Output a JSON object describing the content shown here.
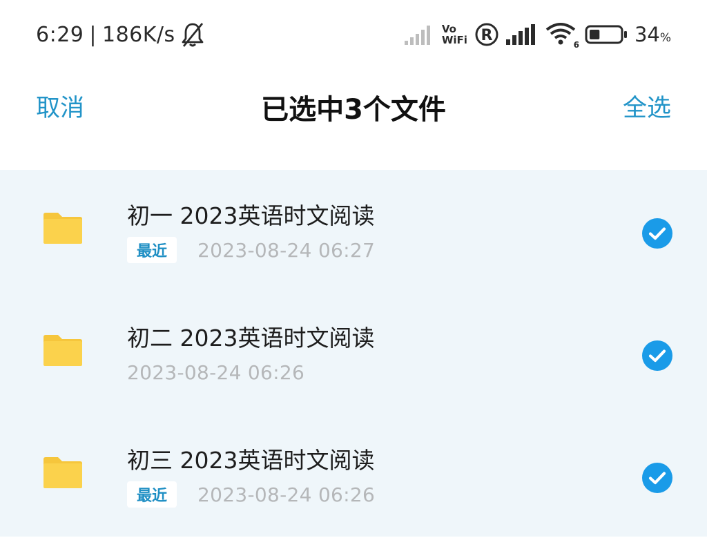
{
  "status_bar": {
    "time": "6:29",
    "separator": "|",
    "net_speed": "186K/s",
    "vowifi_top": "Vo",
    "vowifi_bottom": "WiFi",
    "wifi_badge": "6",
    "battery_percent": "34",
    "battery_unit": "%",
    "battery_level": 0.34,
    "icons": [
      "bell-muted-icon",
      "signal-weak-icon",
      "vowifi-icon",
      "roaming-icon",
      "signal-icon",
      "wifi-icon",
      "battery-icon"
    ]
  },
  "header": {
    "cancel_label": "取消",
    "title": "已选中3个文件",
    "select_all_label": "全选"
  },
  "files": [
    {
      "name": "初一 2023英语时文阅读",
      "badge": "最近",
      "date": "2023-08-24  06:27",
      "selected": true
    },
    {
      "name": "初二 2023英语时文阅读",
      "badge": "",
      "date": "2023-08-24  06:26",
      "selected": true
    },
    {
      "name": "初三 2023英语时文阅读",
      "badge": "最近",
      "date": "2023-08-24  06:26",
      "selected": true
    }
  ],
  "colors": {
    "accent": "#2294c8",
    "check": "#1a9be8",
    "folder": "#fbd14b",
    "list_background": "#eff6fa"
  }
}
